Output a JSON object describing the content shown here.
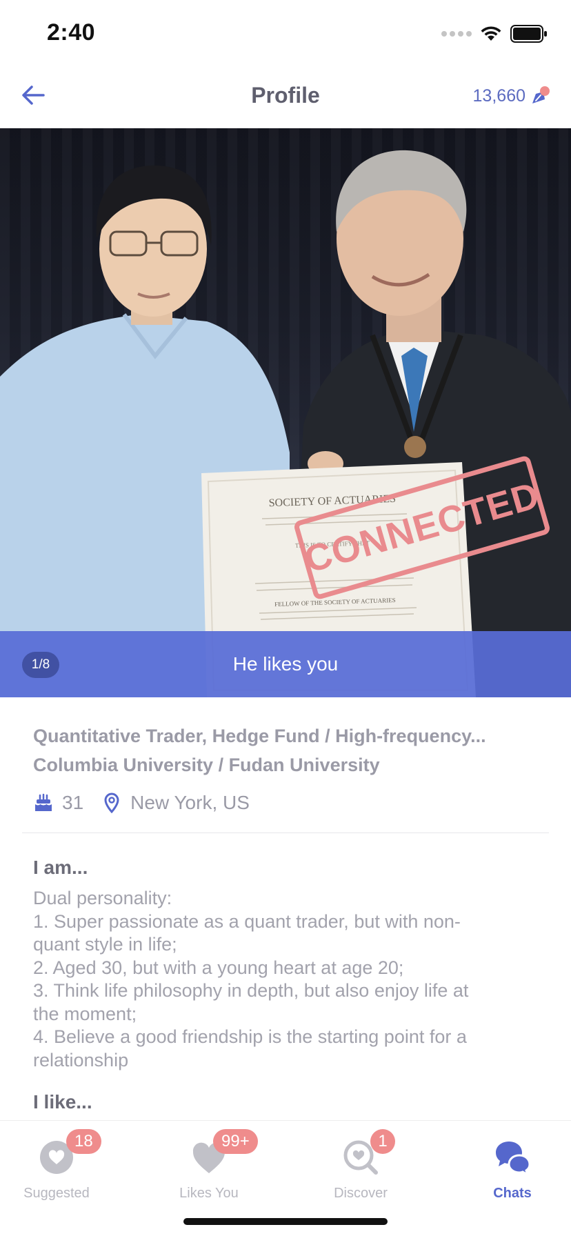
{
  "status_bar": {
    "time": "2:40"
  },
  "nav": {
    "title": "Profile",
    "coins": "13,660"
  },
  "photo": {
    "certificate_header": "SOCIETY OF ACTUARIES",
    "certificate_line": "THIS IS TO CERTIFY THAT",
    "certificate_fellow": "FELLOW OF THE SOCIETY OF ACTUARIES",
    "stamp": "CONNECTED",
    "page_indicator": "1/8",
    "banner": "He likes you"
  },
  "profile": {
    "occupation": "Quantitative Trader, Hedge Fund / High-frequency...",
    "education": "Columbia University / Fudan University",
    "age": "31",
    "location": "New York, US"
  },
  "about": {
    "heading": "I am...",
    "lines": [
      "Dual personality:",
      "1. Super passionate as a quant trader, but with non-",
      "quant style in life;",
      "2. Aged 30, but with a young heart at age 20;",
      "3. Think life philosophy in depth, but also enjoy life at",
      "the moment;",
      "4. Believe a good friendship is the starting point for a",
      "relationship"
    ]
  },
  "likes": {
    "heading": "I like..."
  },
  "tabs": [
    {
      "label": "Suggested",
      "badge": "18",
      "icon": "heart-circle-icon"
    },
    {
      "label": "Likes You",
      "badge": "99+",
      "icon": "heart-icon"
    },
    {
      "label": "Discover",
      "badge": "1",
      "icon": "discover-search-icon"
    },
    {
      "label": "Chats",
      "badge": "",
      "icon": "chat-bubbles-icon"
    }
  ],
  "colors": {
    "accent": "#5567cc",
    "badge": "#ef8c8c",
    "stamp": "#e98b8e",
    "banner": "#586dd6"
  }
}
